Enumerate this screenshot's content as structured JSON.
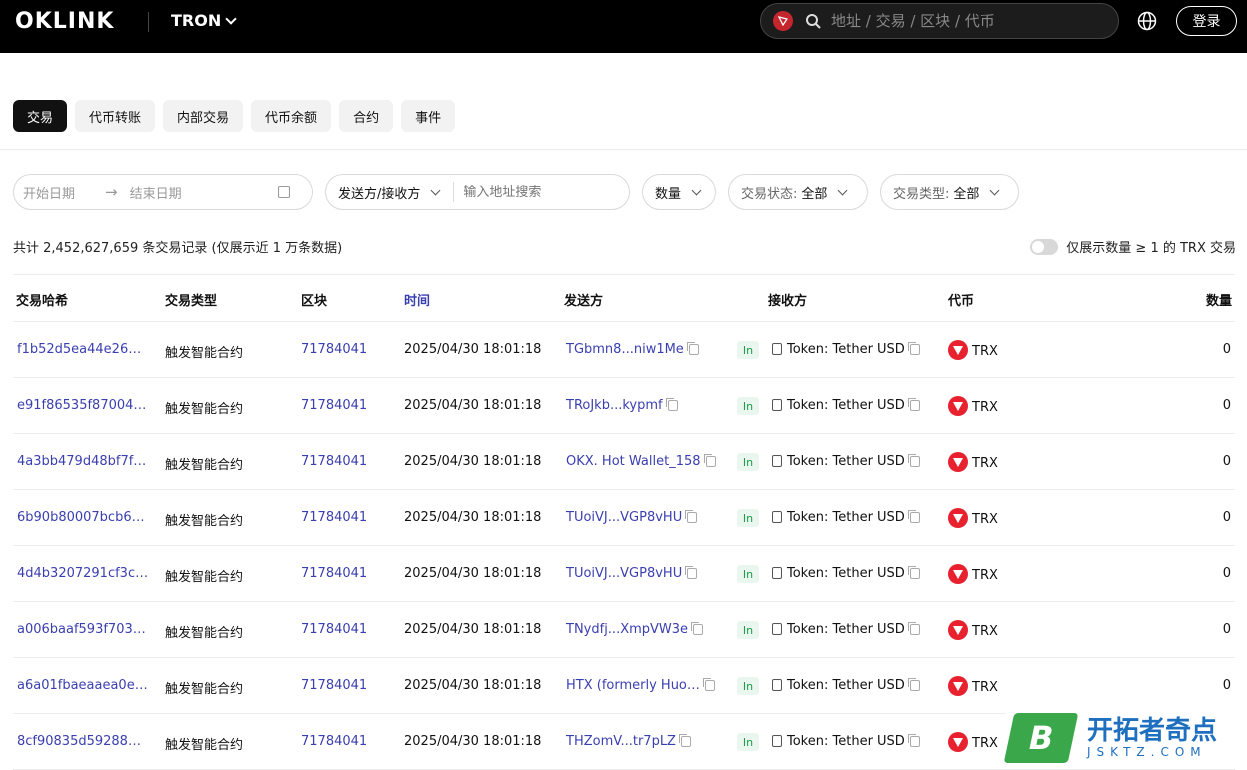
{
  "header": {
    "logo": "OKLINK",
    "chain": "TRON",
    "search_placeholder": "地址 / 交易 / 区块 / 代币",
    "login": "登录"
  },
  "tabs": [
    "交易",
    "代币转账",
    "内部交易",
    "代币余额",
    "合约",
    "事件"
  ],
  "filters": {
    "start_date": "开始日期",
    "end_date": "结束日期",
    "direction": "发送方/接收方",
    "address_placeholder": "输入地址搜索",
    "amount": "数量",
    "status_label": "交易状态:",
    "status_value": "全部",
    "type_label": "交易类型:",
    "type_value": "全部"
  },
  "summary": "共计 2,452,627,659 条交易记录 (仅展示近 1 万条数据)",
  "toggle_label": "仅展示数量 ≥ 1 的 TRX 交易",
  "columns": {
    "hash": "交易哈希",
    "type": "交易类型",
    "block": "区块",
    "time": "时间",
    "from": "发送方",
    "to": "接收方",
    "token": "代币",
    "amount": "数量"
  },
  "rows": [
    {
      "hash": "f1b52d5ea44e26…",
      "type": "触发智能合约",
      "block": "71784041",
      "time": "2025/04/30 18:01:18",
      "from": "TGbmn8...niw1Me",
      "dir": "In",
      "to": "Token: Tether USD",
      "token": "TRX",
      "amount": "0"
    },
    {
      "hash": "e91f86535f87004…",
      "type": "触发智能合约",
      "block": "71784041",
      "time": "2025/04/30 18:01:18",
      "from": "TRoJkb...kypmf",
      "dir": "In",
      "to": "Token: Tether USD",
      "token": "TRX",
      "amount": "0"
    },
    {
      "hash": "4a3bb479d48bf7f…",
      "type": "触发智能合约",
      "block": "71784041",
      "time": "2025/04/30 18:01:18",
      "from": "OKX. Hot Wallet_158",
      "dir": "In",
      "to": "Token: Tether USD",
      "token": "TRX",
      "amount": "0"
    },
    {
      "hash": "6b90b80007bcb6…",
      "type": "触发智能合约",
      "block": "71784041",
      "time": "2025/04/30 18:01:18",
      "from": "TUoiVJ...VGP8vHU",
      "dir": "In",
      "to": "Token: Tether USD",
      "token": "TRX",
      "amount": "0"
    },
    {
      "hash": "4d4b3207291cf3c…",
      "type": "触发智能合约",
      "block": "71784041",
      "time": "2025/04/30 18:01:18",
      "from": "TUoiVJ...VGP8vHU",
      "dir": "In",
      "to": "Token: Tether USD",
      "token": "TRX",
      "amount": "0"
    },
    {
      "hash": "a006baaf593f703…",
      "type": "触发智能合约",
      "block": "71784041",
      "time": "2025/04/30 18:01:18",
      "from": "TNydfj...XmpVW3e",
      "dir": "In",
      "to": "Token: Tether USD",
      "token": "TRX",
      "amount": "0"
    },
    {
      "hash": "a6a01fbaeaaea0e…",
      "type": "触发智能合约",
      "block": "71784041",
      "time": "2025/04/30 18:01:18",
      "from": "HTX (formerly Huo…",
      "dir": "In",
      "to": "Token: Tether USD",
      "token": "TRX",
      "amount": "0"
    },
    {
      "hash": "8cf90835d59288…",
      "type": "触发智能合约",
      "block": "71784041",
      "time": "2025/04/30 18:01:18",
      "from": "THZomV...tr7pLZ",
      "dir": "In",
      "to": "Token: Tether USD",
      "token": "TRX",
      "amount": ""
    }
  ],
  "watermark": {
    "cn": "开拓者奇点",
    "en": "JSKTZ.COM",
    "logo_letter": "B"
  },
  "colors": {
    "link": "#3a3fb0",
    "tron_red": "#e8212f",
    "in_green": "#1e9b4b"
  }
}
